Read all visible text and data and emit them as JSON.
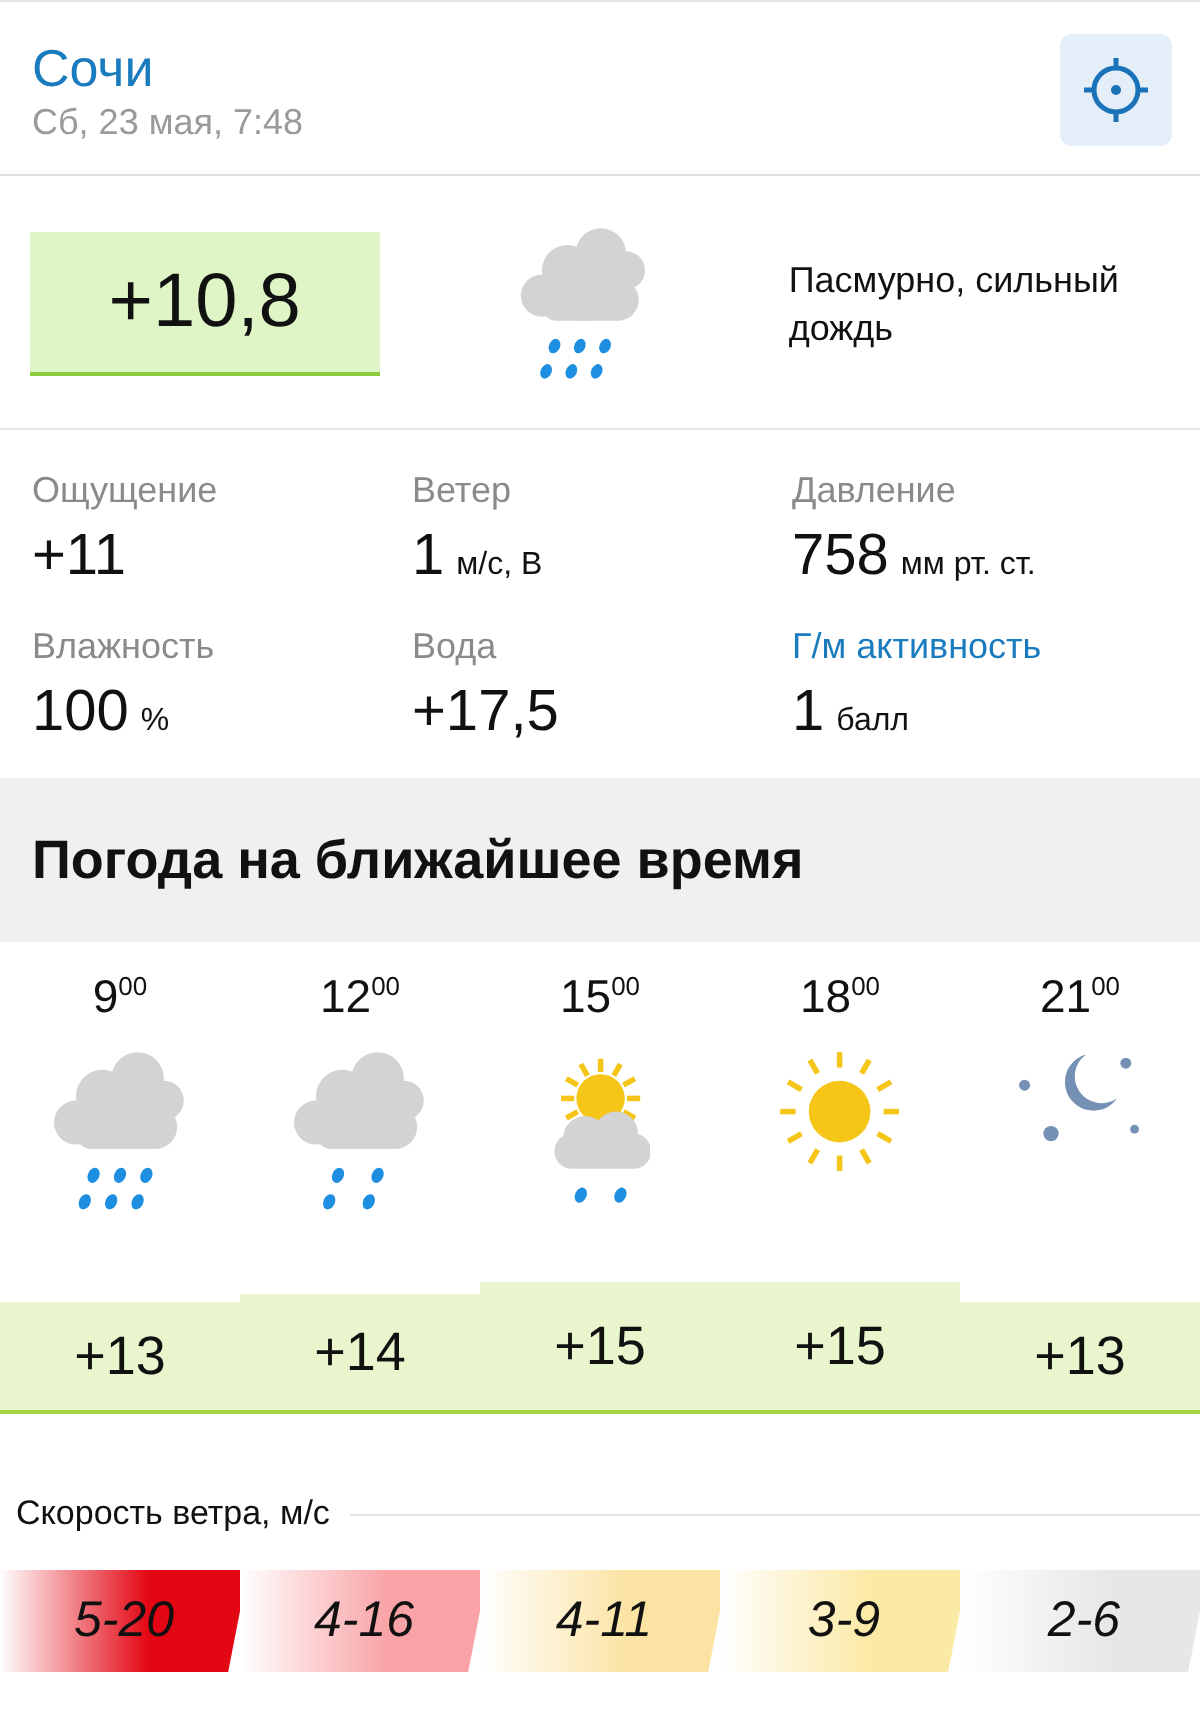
{
  "header": {
    "city": "Сочи",
    "datetime": "Сб, 23 мая, 7:48"
  },
  "current": {
    "temperature": "+10,8",
    "kind": "heavy-rain",
    "condition": "Пасмурно, сильный дождь"
  },
  "details": [
    {
      "label": "Ощущение",
      "value": "+11",
      "kind": "plain"
    },
    {
      "label": "Ветер",
      "value": "1",
      "unit": "м/с, В",
      "kind": "plain"
    },
    {
      "label": "Давление",
      "value": "758",
      "unit": "мм рт. ст.",
      "kind": "plain"
    },
    {
      "label": "Влажность",
      "value": "100",
      "unit": "%",
      "kind": "plain"
    },
    {
      "label": "Вода",
      "value": "+17,5",
      "kind": "plain"
    },
    {
      "label": "Г/м активность",
      "value": "1",
      "unit": "балл",
      "kind": "link"
    }
  ],
  "forecast_title": "Погода на ближайшее время",
  "hourly": [
    {
      "hour": "9",
      "minutes": "00",
      "kind": "heavy-rain",
      "temperature": "+13"
    },
    {
      "hour": "12",
      "minutes": "00",
      "kind": "rain",
      "temperature": "+14"
    },
    {
      "hour": "15",
      "minutes": "00",
      "kind": "sun-cloud-rain",
      "temperature": "+15"
    },
    {
      "hour": "18",
      "minutes": "00",
      "kind": "sun",
      "temperature": "+15"
    },
    {
      "hour": "21",
      "minutes": "00",
      "kind": "night",
      "temperature": "+13"
    }
  ],
  "wind_title": "Скорость ветра, м/с",
  "wind": [
    {
      "range": "5-20",
      "color": "#e30613"
    },
    {
      "range": "4-16",
      "color": "#f9a3a6"
    },
    {
      "range": "4-11",
      "color": "#fbe3a3"
    },
    {
      "range": "3-9",
      "color": "#fbe9a6"
    },
    {
      "range": "2-6",
      "color": "#e6e7e9"
    }
  ]
}
